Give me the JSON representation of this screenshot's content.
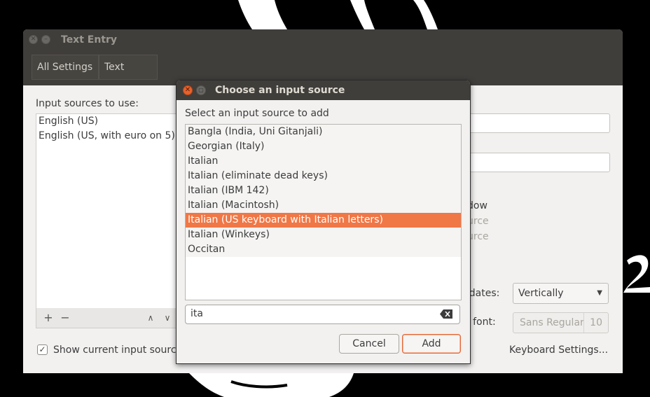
{
  "main_window": {
    "title": "Text Entry",
    "breadcrumbs": [
      "All Settings",
      "Text Entry"
    ],
    "input_sources_label": "Input sources to use:",
    "input_sources": [
      "English (US)",
      "English (US, with euro on 5)"
    ],
    "add_symbol": "+",
    "remove_symbol": "−",
    "up_symbol": "∧",
    "down_symbol": "∨",
    "partial_text": [
      "dow",
      "urce",
      "urce"
    ],
    "candidates_label": "didates:",
    "candidates_value": "Vertically",
    "custom_font_label": "m font:",
    "custom_font_name": "Sans Regular",
    "custom_font_size": "10",
    "show_current_source_label": "Show current input source",
    "keyboard_settings_link": "Keyboard Settings..."
  },
  "dialog": {
    "title": "Choose an input source",
    "prompt": "Select an input source to add",
    "options": [
      "Bangla (India, Uni Gitanjali)",
      "Georgian (Italy)",
      "Italian",
      "Italian (eliminate dead keys)",
      "Italian (IBM 142)",
      "Italian (Macintosh)",
      "Italian (US keyboard with Italian letters)",
      "Italian (Winkeys)",
      "Occitan"
    ],
    "selected_option": "Italian (US keyboard with Italian letters)",
    "search_value": "ita",
    "cancel_label": "Cancel",
    "add_label": "Add"
  },
  "colors": {
    "accent": "#f07746",
    "titlebar": "#403e3b",
    "window_bg": "#f2f1f0",
    "close_button": "#e9612c"
  }
}
